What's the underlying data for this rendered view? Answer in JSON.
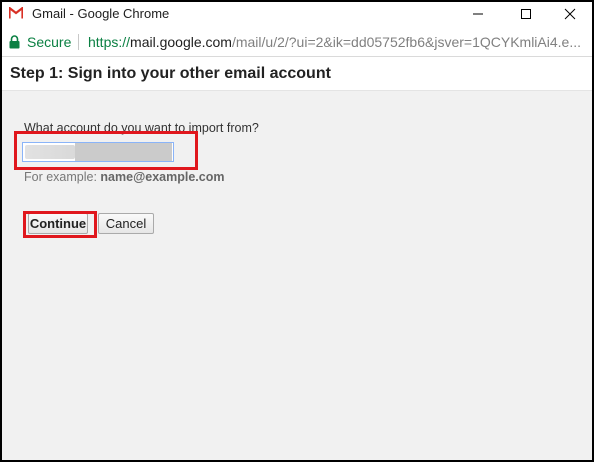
{
  "window": {
    "title": "Gmail - Google Chrome",
    "controls": {
      "minimize": "minimize-icon",
      "maximize": "maximize-icon",
      "close": "close-icon"
    }
  },
  "addressbar": {
    "secure_label": "Secure",
    "url_scheme": "https://",
    "url_host": "mail.google.com",
    "url_rest": "/mail/u/2/?ui=2&ik=dd05752fb6&jsver=1QCYKmliAi4.e..."
  },
  "step": {
    "title": "Step 1: Sign into your other email account"
  },
  "form": {
    "question": "What account do you want to import from?",
    "email_value": "",
    "example_prefix": "For example: ",
    "example_value": "name@example.com",
    "continue_label": "Continue",
    "cancel_label": "Cancel"
  },
  "colors": {
    "highlight": "#e0171d",
    "secure_green": "#0b8043",
    "content_bg": "#f1f1f1",
    "gmail_red": "#d93025"
  },
  "icons": [
    "gmail-logo-icon",
    "lock-icon",
    "minimize-icon",
    "maximize-icon",
    "close-icon"
  ]
}
